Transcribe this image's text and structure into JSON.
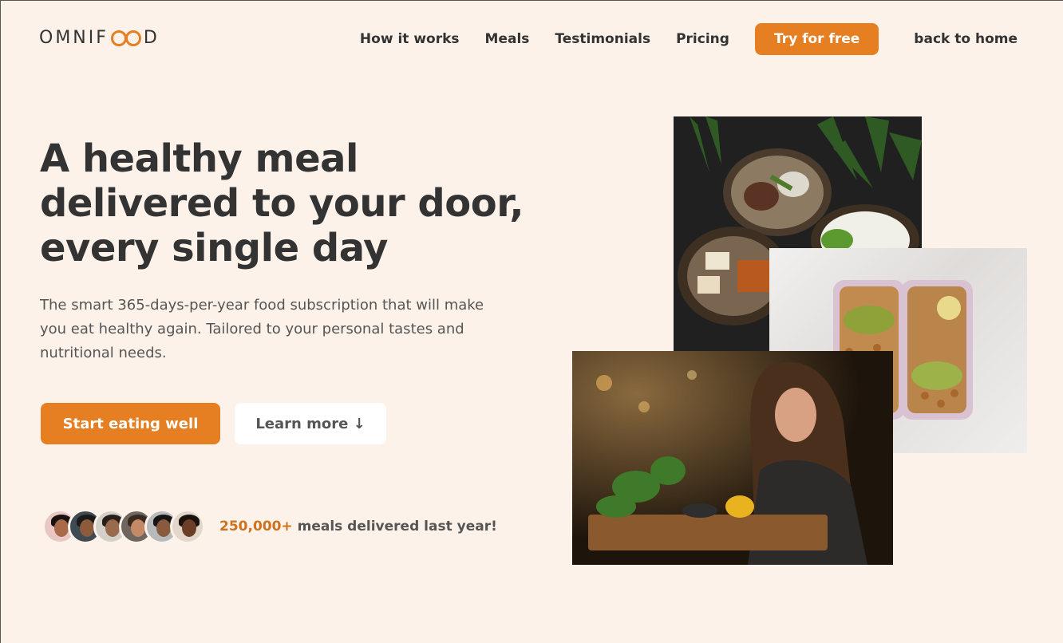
{
  "brand": {
    "logo_prefix": "OMNIF",
    "logo_suffix": "D",
    "accent": "#e67e22",
    "background": "#fdf2e9",
    "text_dark": "#333333"
  },
  "nav": {
    "items": [
      {
        "label": "How it works"
      },
      {
        "label": "Meals"
      },
      {
        "label": "Testimonials"
      },
      {
        "label": "Pricing"
      }
    ],
    "cta_label": "Try for free",
    "home_label": "back to home"
  },
  "hero": {
    "title": "A healthy meal delivered to your door, every single day",
    "description": "The smart 365-days-per-year food subscription that will make you eat healthy again. Tailored to your personal tastes and nutritional needs.",
    "primary_button": "Start eating well",
    "secondary_button": "Learn more ↓",
    "delivered_count": "250,000+",
    "delivered_text": " meals delivered last year!"
  },
  "icons": {
    "logo_mark": "infinity-loop-icon",
    "arrow": "arrow-down"
  }
}
